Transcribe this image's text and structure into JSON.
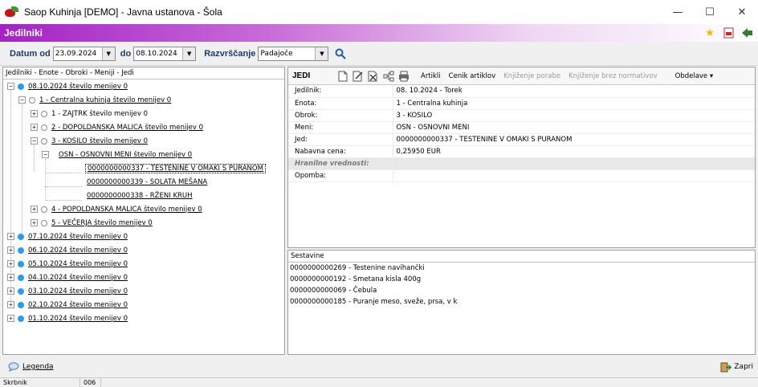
{
  "window": {
    "title": "Saop Kuhinja  [DEMO] - Javna ustanova - Šola",
    "minimize": "—",
    "maximize": "☐",
    "close": "✕"
  },
  "header": {
    "title": "Jedilniki",
    "icons": [
      "star-icon",
      "pdf-icon",
      "exit-icon"
    ]
  },
  "filters": {
    "date_from_label": "Datum od",
    "date_from": "23.09.2024",
    "date_to_label": "do",
    "date_to": "08.10.2024",
    "sort_label": "Razvrščanje",
    "sort_value": "Padajoče"
  },
  "tree": {
    "header": "Jedilniki - Enote - Obroki - Meniji - Jedi",
    "rows": [
      {
        "text": "08.10.2024  število menijev 0"
      },
      {
        "text": "1 - Centralna kuhinja  število menijev 0"
      },
      {
        "text": "1 - ZAJTRK  število menijev 0"
      },
      {
        "text": "2 - DOPOLDANSKA MALICA  število menijev 0"
      },
      {
        "text": "3 - KOSILO  število menijev 0"
      },
      {
        "text": "OSN - OSNOVNI MENI  število menijev 0"
      },
      {
        "text": "0000000000337 - TESTENINE V OMAKI S PURANOM"
      },
      {
        "text": "0000000000339 - SOLATA MEŠANA"
      },
      {
        "text": "0000000000338 - RŽENI KRUH"
      },
      {
        "text": "4 - POPOLDANSKA MALICA  število menijev 0"
      },
      {
        "text": "5 - VEČERJA  število menijev 0"
      },
      {
        "text": "07.10.2024  število menijev 0"
      },
      {
        "text": "06.10.2024  število menijev 0"
      },
      {
        "text": "05.10.2024  število menijev 0"
      },
      {
        "text": "04.10.2024  število menijev 0"
      },
      {
        "text": "03.10.2024  število menijev 0"
      },
      {
        "text": "02.10.2024  število menijev 0"
      },
      {
        "text": "01.10.2024  število menijev 0"
      }
    ]
  },
  "detail": {
    "title": "JEDI",
    "buttons": {
      "artikli": "Artikli",
      "cenik": "Cenik artiklov",
      "knjizenje": "Knjiženje porabe",
      "knjizenje_brez": "Knjiženje brez normativov",
      "obdelave": "Obdelave ▾"
    },
    "props": [
      {
        "key": "Jedilnik:",
        "value": "08. 10.2024 - Torek"
      },
      {
        "key": "Enota:",
        "value": "1 - Centralna kuhinja"
      },
      {
        "key": "Obrok:",
        "value": "3 - KOSILO"
      },
      {
        "key": "Meni:",
        "value": "OSN - OSNOVNI MENI"
      },
      {
        "key": "Jed:",
        "value": "0000000000337 - TESTENINE V OMAKI S PURANOM"
      },
      {
        "key": "Nabavna cena:",
        "value": "0,25950 EUR"
      },
      {
        "key": "Hranilne vrednosti:",
        "value": ""
      },
      {
        "key": "Opomba:",
        "value": ""
      }
    ]
  },
  "ingredients": {
    "header": "Sestavine",
    "items": [
      "0000000000269 - Testenine navihančki",
      "0000000000192 - Smetana kisla 400g",
      "0000000000069 - Čebula",
      "0000000000185 - Puranje meso, sveže, prsa, v k"
    ]
  },
  "bottom": {
    "legend": "Legenda",
    "close": "Zapri"
  },
  "status": {
    "user": "Skrbnik",
    "code": "006"
  }
}
